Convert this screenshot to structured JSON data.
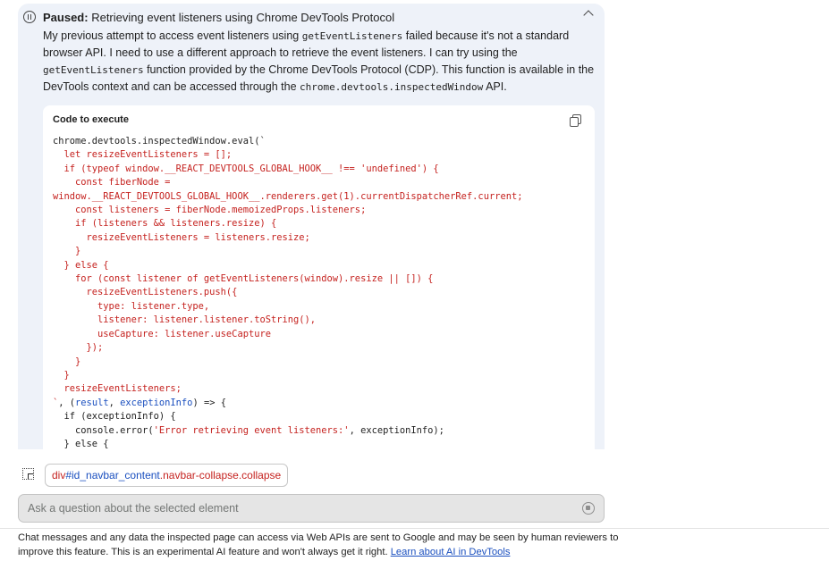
{
  "header": {
    "status_label": "Paused:",
    "status_text": "Retrieving event listeners using Chrome DevTools Protocol"
  },
  "message": {
    "p1": "My previous attempt to access event listeners using ",
    "c1": "getEventListeners",
    "p2": " failed because it's not a standard browser API. I need to use a different approach to retrieve the event listeners. I can try using the ",
    "c2": "getEventListeners",
    "p3": " function provided by the Chrome DevTools Protocol (CDP). This function is available in the DevTools context and can be accessed through the ",
    "c3": "chrome.devtools.inspectedWindow",
    "p4": " API."
  },
  "code_block": {
    "title": "Code to execute",
    "lines": [
      {
        "seg": [
          {
            "t": "chrome.devtools.inspectedWindow.eval(`",
            "c": "ck"
          }
        ]
      },
      {
        "seg": [
          {
            "t": "  let resizeEventListeners = [];",
            "c": ""
          }
        ]
      },
      {
        "seg": [
          {
            "t": "  if (typeof window.__REACT_DEVTOOLS_GLOBAL_HOOK__ !== 'undefined') {",
            "c": ""
          }
        ]
      },
      {
        "seg": [
          {
            "t": "    const fiberNode =",
            "c": ""
          }
        ]
      },
      {
        "seg": [
          {
            "t": "window.__REACT_DEVTOOLS_GLOBAL_HOOK__.renderers.get(1).currentDispatcherRef.current;",
            "c": ""
          }
        ]
      },
      {
        "seg": [
          {
            "t": "    const listeners = fiberNode.memoizedProps.listeners;",
            "c": ""
          }
        ]
      },
      {
        "seg": [
          {
            "t": "    if (listeners && listeners.resize) {",
            "c": ""
          }
        ]
      },
      {
        "seg": [
          {
            "t": "      resizeEventListeners = listeners.resize;",
            "c": ""
          }
        ]
      },
      {
        "seg": [
          {
            "t": "    }",
            "c": ""
          }
        ]
      },
      {
        "seg": [
          {
            "t": "  } else {",
            "c": ""
          }
        ]
      },
      {
        "seg": [
          {
            "t": "    for (const listener of getEventListeners(window).resize || []) {",
            "c": ""
          }
        ]
      },
      {
        "seg": [
          {
            "t": "      resizeEventListeners.push({",
            "c": ""
          }
        ]
      },
      {
        "seg": [
          {
            "t": "        type: listener.type,",
            "c": ""
          }
        ]
      },
      {
        "seg": [
          {
            "t": "        listener: listener.listener.toString(),",
            "c": ""
          }
        ]
      },
      {
        "seg": [
          {
            "t": "        useCapture: listener.useCapture",
            "c": ""
          }
        ]
      },
      {
        "seg": [
          {
            "t": "      });",
            "c": ""
          }
        ]
      },
      {
        "seg": [
          {
            "t": "    }",
            "c": ""
          }
        ]
      },
      {
        "seg": [
          {
            "t": "  }",
            "c": ""
          }
        ]
      },
      {
        "seg": [
          {
            "t": "  resizeEventListeners;",
            "c": ""
          }
        ]
      },
      {
        "seg": [
          {
            "t": "`",
            "c": ""
          },
          {
            "t": ", (",
            "c": "ck"
          },
          {
            "t": "result",
            "c": "cb"
          },
          {
            "t": ", ",
            "c": "ck"
          },
          {
            "t": "exceptionInfo",
            "c": "cb"
          },
          {
            "t": ") => {",
            "c": "ck"
          }
        ]
      },
      {
        "seg": [
          {
            "t": "  if (exceptionInfo) {",
            "c": "ck"
          }
        ]
      },
      {
        "seg": [
          {
            "t": "    console.error(",
            "c": "ck"
          },
          {
            "t": "'Error retrieving event listeners:'",
            "c": ""
          },
          {
            "t": ", exceptionInfo);",
            "c": "ck"
          }
        ]
      },
      {
        "seg": [
          {
            "t": "  } else {",
            "c": "ck"
          }
        ]
      }
    ]
  },
  "context_chip": {
    "tag": "div",
    "selector": "#id_navbar_content",
    "classes": ".navbar-collapse.collapse"
  },
  "input": {
    "placeholder": "Ask a question about the selected element"
  },
  "footer": {
    "disclaimer": "Chat messages and any data the inspected page can access via Web APIs are sent to Google and may be seen by human reviewers to improve this feature. This is an experimental AI feature and won't always get it right. ",
    "link": "Learn about AI in DevTools"
  }
}
